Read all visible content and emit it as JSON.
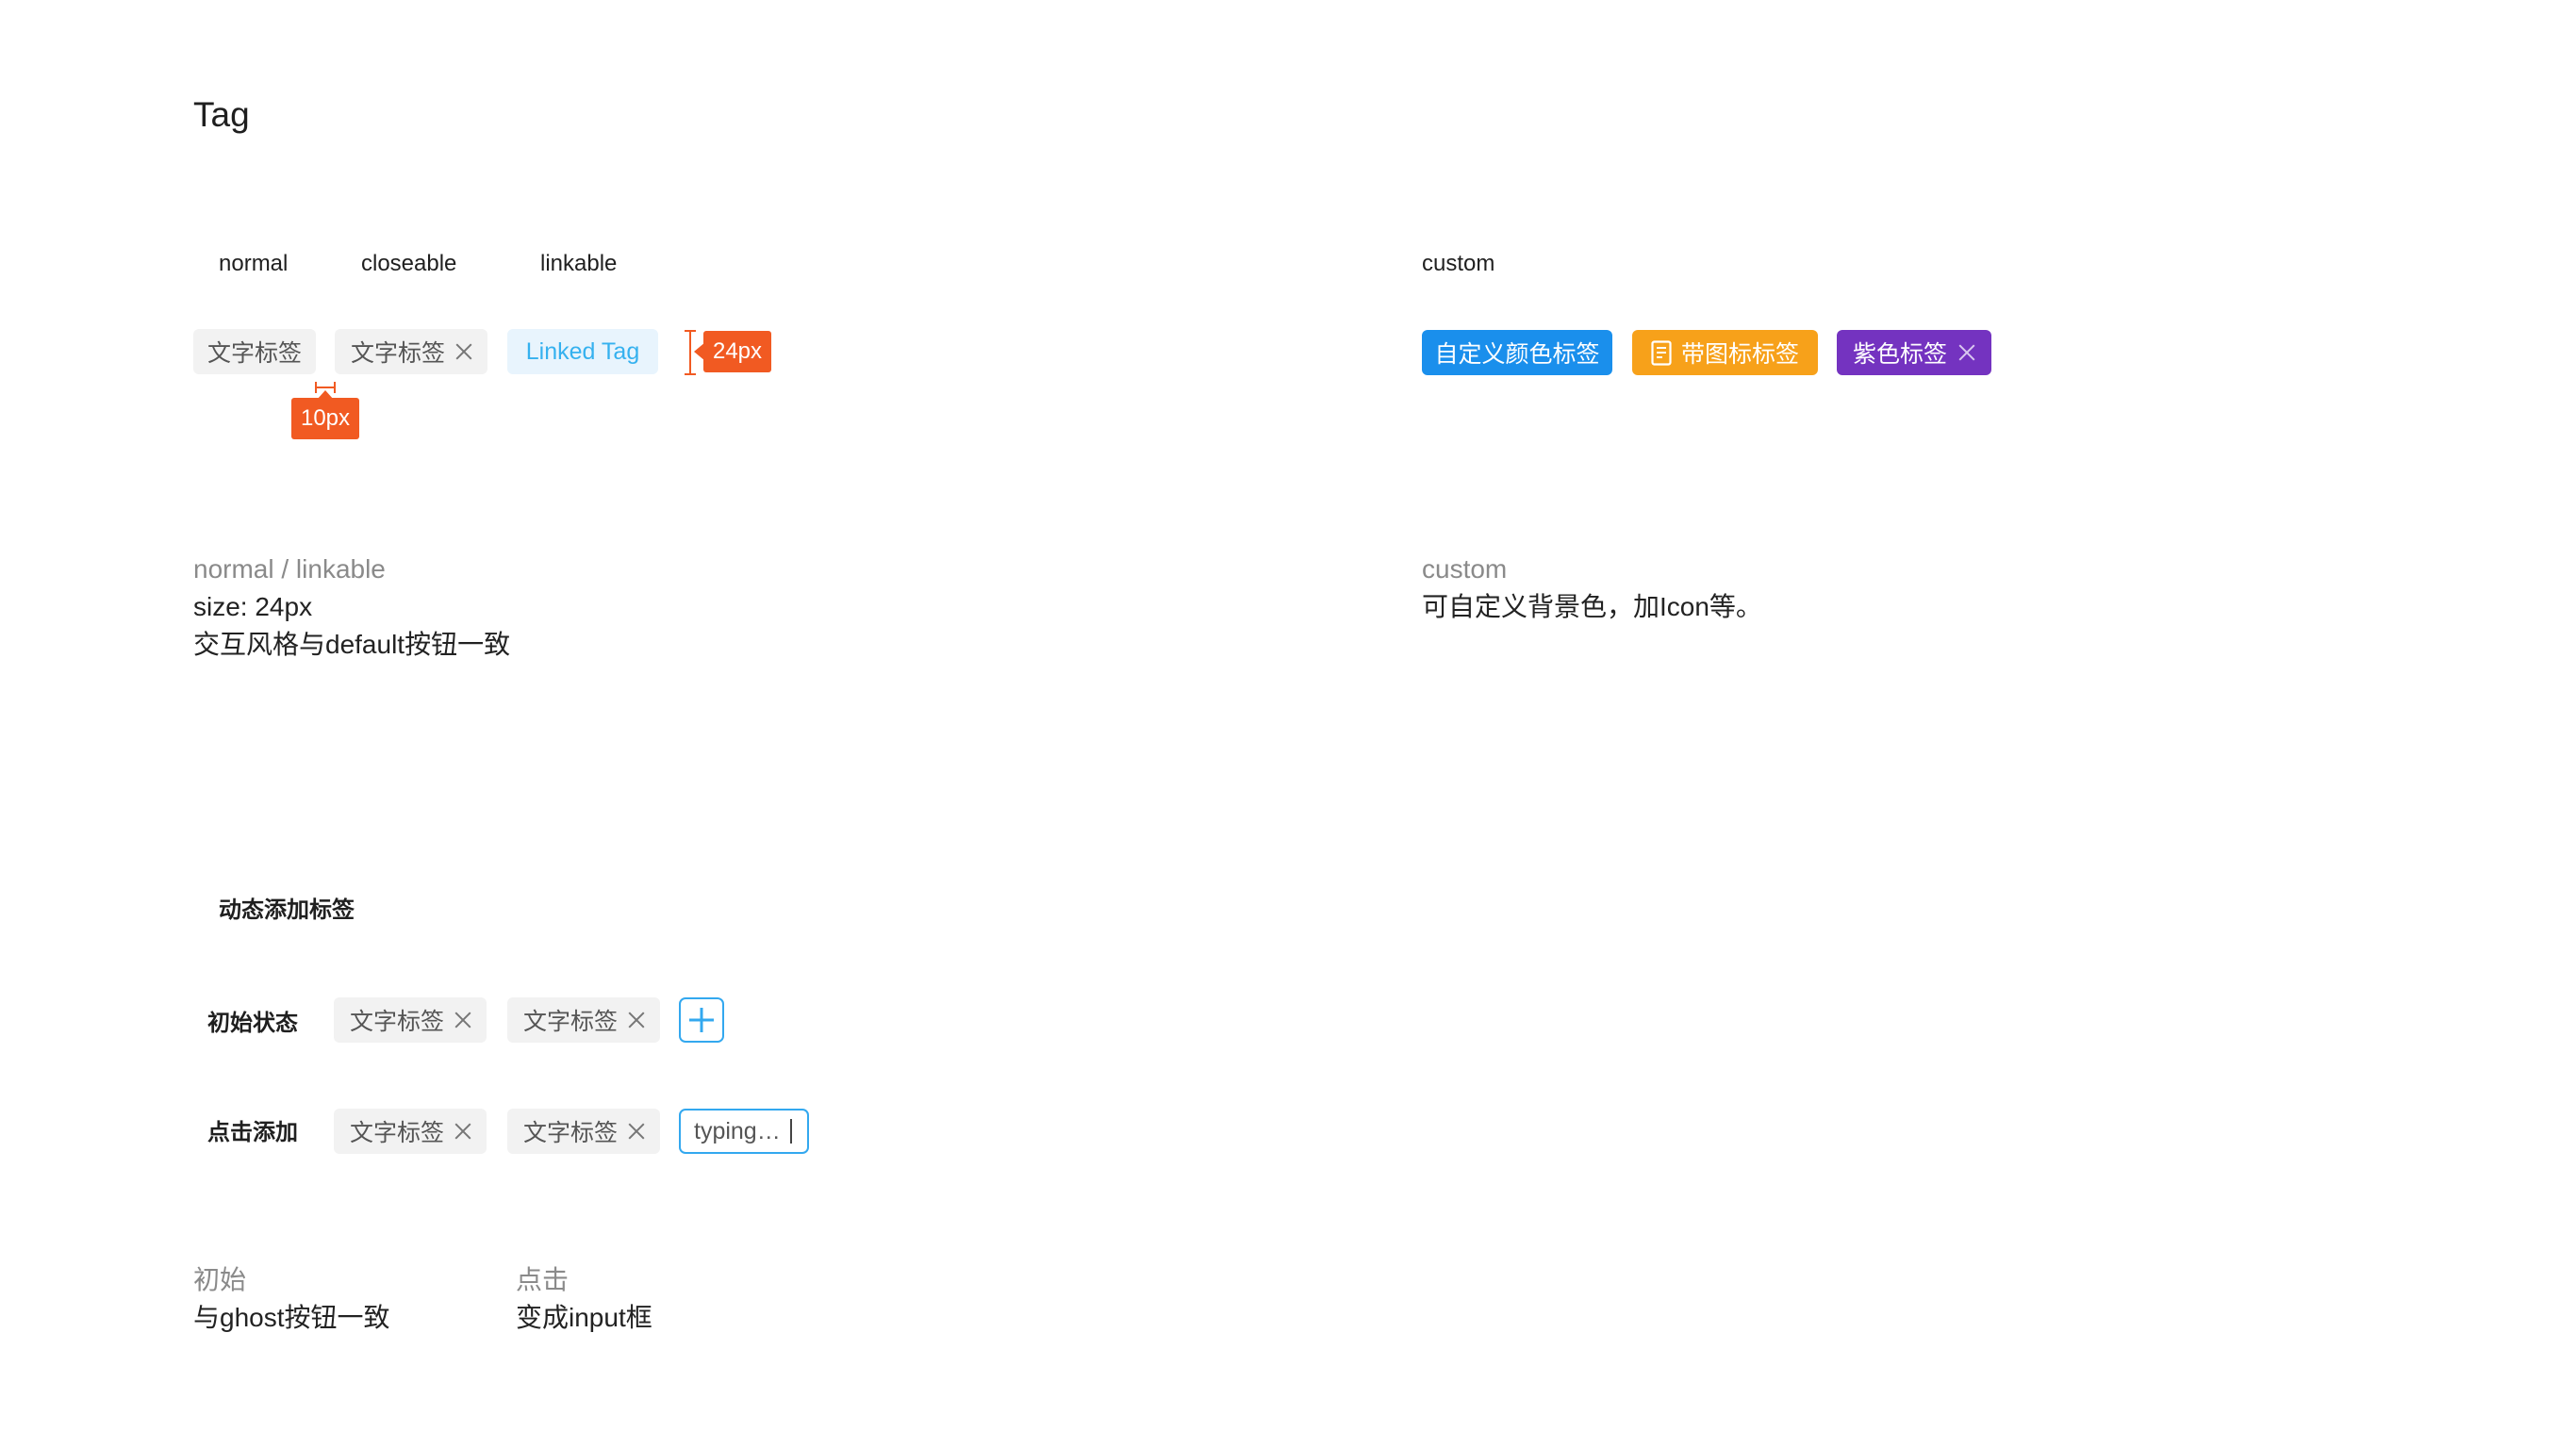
{
  "page": {
    "title": "Tag"
  },
  "basic": {
    "labels": {
      "normal": "normal",
      "closeable": "closeable",
      "linkable": "linkable"
    },
    "tag_normal": "文字标签",
    "tag_closeable": "文字标签",
    "tag_linked": "Linked Tag",
    "height_badge": "24px",
    "spacing_badge": "10px"
  },
  "custom": {
    "label": "custom",
    "tag_blue": "自定义颜色标签",
    "tag_orange": "带图标标签",
    "tag_purple": "紫色标签",
    "colors": {
      "blue": "#1a8fec",
      "orange": "#f7a11a",
      "purple": "#7433c0"
    },
    "icon": "document-icon"
  },
  "desc_left": {
    "line1": "normal / linkable",
    "line2": "size: 24px",
    "line3": "交互风格与default按钮一致"
  },
  "desc_right": {
    "line1": "custom",
    "line2": "可自定义背景色，加Icon等。"
  },
  "dynamic": {
    "title": "动态添加标签",
    "row1_label": "初始状态",
    "row2_label": "点击添加",
    "tags": [
      "文字标签",
      "文字标签"
    ],
    "typing_text": "typing…",
    "plus_icon": "plus-icon"
  },
  "desc_bottom": {
    "col1_line1": "初始",
    "col1_line2": "与ghost按钮一致",
    "col2_line1": "点击",
    "col2_line2": "变成input框"
  },
  "accent_color": "#33a8ef",
  "measure_color": "#f15a22"
}
